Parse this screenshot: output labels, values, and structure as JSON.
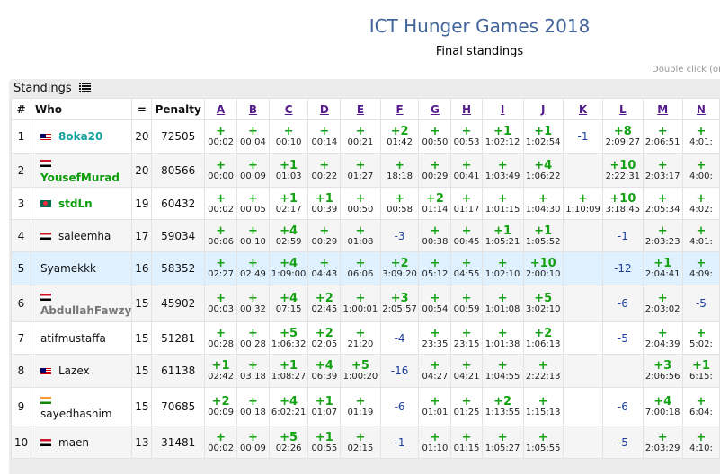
{
  "title": "ICT Hunger Games 2018",
  "subtitle": "Final standings",
  "hint": "Double click (on",
  "panel_title": "Standings",
  "columns": {
    "rank": "#",
    "who": "Who",
    "solved": "=",
    "penalty": "Penalty"
  },
  "problems": [
    "A",
    "B",
    "C",
    "D",
    "E",
    "F",
    "G",
    "H",
    "I",
    "J",
    "K",
    "L",
    "M",
    "N"
  ],
  "rows": [
    {
      "rank": "1",
      "flag": "my",
      "name": "8oka20",
      "name_style": "teal",
      "solved": "20",
      "penalty": "72505",
      "highlight": false,
      "cells": [
        [
          "+",
          "00:02"
        ],
        [
          "+",
          "00:04"
        ],
        [
          "+",
          "00:10"
        ],
        [
          "+",
          "00:14"
        ],
        [
          "+",
          "00:21"
        ],
        [
          "+2",
          "01:42"
        ],
        [
          "+",
          "00:50"
        ],
        [
          "+",
          "00:53"
        ],
        [
          "+1",
          "1:02:12"
        ],
        [
          "+1",
          "1:02:54"
        ],
        [
          "-1",
          ""
        ],
        [
          "+8",
          "2:09:27"
        ],
        [
          "+",
          "2:06:51"
        ],
        [
          "+",
          "4:01:"
        ]
      ]
    },
    {
      "rank": "2",
      "flag": "eg",
      "name": "YousefMurad",
      "name_style": "green",
      "solved": "20",
      "penalty": "80566",
      "highlight": false,
      "cells": [
        [
          "+",
          "00:00"
        ],
        [
          "+",
          "00:09"
        ],
        [
          "+1",
          "01:03"
        ],
        [
          "+",
          "00:22"
        ],
        [
          "+",
          "01:27"
        ],
        [
          "+",
          "18:18"
        ],
        [
          "+",
          "00:29"
        ],
        [
          "+",
          "00:41"
        ],
        [
          "+",
          "1:03:49"
        ],
        [
          "+4",
          "1:06:22"
        ],
        [
          "",
          ""
        ],
        [
          "+10",
          "2:22:31"
        ],
        [
          "+",
          "2:03:17"
        ],
        [
          "+",
          "4:00:"
        ]
      ]
    },
    {
      "rank": "3",
      "flag": "bd",
      "name": "stdLn",
      "name_style": "green",
      "solved": "19",
      "penalty": "60432",
      "highlight": false,
      "cells": [
        [
          "+",
          "00:02"
        ],
        [
          "+",
          "00:05"
        ],
        [
          "+1",
          "02:17"
        ],
        [
          "+1",
          "00:39"
        ],
        [
          "+",
          "00:50"
        ],
        [
          "+",
          "00:58"
        ],
        [
          "+2",
          "01:14"
        ],
        [
          "+",
          "01:17"
        ],
        [
          "+",
          "1:01:15"
        ],
        [
          "+",
          "1:04:30"
        ],
        [
          "+",
          "1:10:09"
        ],
        [
          "+10",
          "3:18:45"
        ],
        [
          "+",
          "2:05:34"
        ],
        [
          "+",
          "4:02:"
        ]
      ]
    },
    {
      "rank": "4",
      "flag": "eg",
      "name": "saleemha",
      "name_style": "",
      "solved": "17",
      "penalty": "59034",
      "highlight": false,
      "cells": [
        [
          "+",
          "00:06"
        ],
        [
          "+",
          "00:10"
        ],
        [
          "+4",
          "02:59"
        ],
        [
          "+",
          "00:29"
        ],
        [
          "+",
          "01:08"
        ],
        [
          "-3",
          ""
        ],
        [
          "+",
          "00:38"
        ],
        [
          "+",
          "00:45"
        ],
        [
          "+1",
          "1:05:21"
        ],
        [
          "+1",
          "1:05:52"
        ],
        [
          "",
          ""
        ],
        [
          "-1",
          ""
        ],
        [
          "+",
          "2:03:23"
        ],
        [
          "+",
          "4:01:"
        ]
      ]
    },
    {
      "rank": "5",
      "flag": "",
      "name": "Syamekkk",
      "name_style": "",
      "solved": "16",
      "penalty": "58352",
      "highlight": true,
      "cells": [
        [
          "+",
          "02:27"
        ],
        [
          "+",
          "02:49"
        ],
        [
          "+4",
          "1:09:00"
        ],
        [
          "+",
          "04:43"
        ],
        [
          "+",
          "06:06"
        ],
        [
          "+2",
          "3:09:20"
        ],
        [
          "+",
          "05:12"
        ],
        [
          "+",
          "04:55"
        ],
        [
          "+",
          "1:02:10"
        ],
        [
          "+10",
          "2:00:10"
        ],
        [
          "",
          ""
        ],
        [
          "-12",
          ""
        ],
        [
          "+1",
          "2:04:41"
        ],
        [
          "+",
          "4:09:"
        ]
      ]
    },
    {
      "rank": "6",
      "flag": "eg",
      "name": "AbdullahFawzy",
      "name_style": "gray",
      "solved": "15",
      "penalty": "45902",
      "highlight": false,
      "cells": [
        [
          "+",
          "00:03"
        ],
        [
          "+",
          "00:32"
        ],
        [
          "+4",
          "07:15"
        ],
        [
          "+2",
          "02:45"
        ],
        [
          "+",
          "1:00:01"
        ],
        [
          "+3",
          "2:05:57"
        ],
        [
          "+",
          "00:54"
        ],
        [
          "+",
          "00:59"
        ],
        [
          "+",
          "1:01:08"
        ],
        [
          "+5",
          "3:02:10"
        ],
        [
          "",
          ""
        ],
        [
          "-6",
          ""
        ],
        [
          "+",
          "2:03:02"
        ],
        [
          "-5",
          ""
        ]
      ]
    },
    {
      "rank": "7",
      "flag": "",
      "name": "atifmustaffa",
      "name_style": "",
      "solved": "15",
      "penalty": "51281",
      "highlight": false,
      "cells": [
        [
          "+",
          "00:28"
        ],
        [
          "+",
          "00:28"
        ],
        [
          "+5",
          "1:06:32"
        ],
        [
          "+2",
          "02:05"
        ],
        [
          "+",
          "21:20"
        ],
        [
          "-4",
          ""
        ],
        [
          "+",
          "23:35"
        ],
        [
          "+",
          "23:15"
        ],
        [
          "+",
          "1:01:38"
        ],
        [
          "+2",
          "1:06:13"
        ],
        [
          "",
          ""
        ],
        [
          "-5",
          ""
        ],
        [
          "+",
          "2:04:39"
        ],
        [
          "+",
          "5:02:"
        ]
      ]
    },
    {
      "rank": "8",
      "flag": "my",
      "name": "Lazex",
      "name_style": "",
      "solved": "15",
      "penalty": "61138",
      "highlight": false,
      "cells": [
        [
          "+1",
          "02:42"
        ],
        [
          "+",
          "03:18"
        ],
        [
          "+1",
          "1:08:27"
        ],
        [
          "+4",
          "06:39"
        ],
        [
          "+5",
          "1:00:20"
        ],
        [
          "-16",
          ""
        ],
        [
          "+",
          "04:27"
        ],
        [
          "+",
          "04:21"
        ],
        [
          "+",
          "1:04:55"
        ],
        [
          "+",
          "2:22:13"
        ],
        [
          "",
          ""
        ],
        [
          "",
          ""
        ],
        [
          "+3",
          "2:06:56"
        ],
        [
          "+1",
          "6:15:"
        ]
      ]
    },
    {
      "rank": "9",
      "flag": "in",
      "name": "sayedhashim",
      "name_style": "",
      "solved": "15",
      "penalty": "70685",
      "highlight": false,
      "cells": [
        [
          "+2",
          "00:09"
        ],
        [
          "+",
          "00:18"
        ],
        [
          "+4",
          "6:02:21"
        ],
        [
          "+1",
          "01:07"
        ],
        [
          "+",
          "01:19"
        ],
        [
          "-6",
          ""
        ],
        [
          "+",
          "01:01"
        ],
        [
          "+",
          "01:25"
        ],
        [
          "+2",
          "1:13:55"
        ],
        [
          "+",
          "1:15:13"
        ],
        [
          "",
          ""
        ],
        [
          "-6",
          ""
        ],
        [
          "+4",
          "7:00:18"
        ],
        [
          "+",
          "6:04:"
        ]
      ]
    },
    {
      "rank": "10",
      "flag": "eg",
      "name": "maen",
      "name_style": "",
      "solved": "13",
      "penalty": "31481",
      "highlight": false,
      "cells": [
        [
          "+",
          "00:02"
        ],
        [
          "+",
          "00:09"
        ],
        [
          "+5",
          "02:26"
        ],
        [
          "+1",
          "00:55"
        ],
        [
          "+",
          "02:15"
        ],
        [
          "-1",
          ""
        ],
        [
          "+",
          "01:10"
        ],
        [
          "+",
          "01:15"
        ],
        [
          "+",
          "1:05:27"
        ],
        [
          "+",
          "1:05:55"
        ],
        [
          "",
          ""
        ],
        [
          "-5",
          ""
        ],
        [
          "+",
          "2:03:29"
        ],
        [
          "+",
          "4:10:"
        ]
      ]
    }
  ]
}
